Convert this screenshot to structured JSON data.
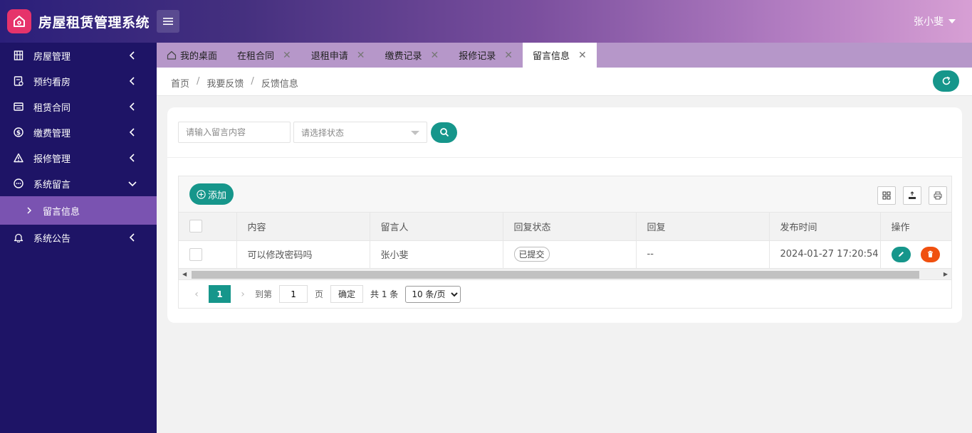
{
  "app": {
    "title": "房屋租赁管理系统",
    "user": "张小斐"
  },
  "sidebar": {
    "items": [
      {
        "label": "房屋管理",
        "icon": "building-icon"
      },
      {
        "label": "预约看房",
        "icon": "calendar-icon"
      },
      {
        "label": "租赁合同",
        "icon": "contract-icon"
      },
      {
        "label": "缴费管理",
        "icon": "dollar-icon"
      },
      {
        "label": "报修管理",
        "icon": "warning-icon"
      },
      {
        "label": "系统留言",
        "icon": "message-icon",
        "expanded": true
      },
      {
        "label": "系统公告",
        "icon": "bell-icon"
      }
    ],
    "sub_item": "留言信息"
  },
  "tabs": [
    {
      "label": "我的桌面",
      "closable": false,
      "active": false
    },
    {
      "label": "在租合同",
      "closable": true,
      "active": false
    },
    {
      "label": "退租申请",
      "closable": true,
      "active": false
    },
    {
      "label": "缴费记录",
      "closable": true,
      "active": false
    },
    {
      "label": "报修记录",
      "closable": true,
      "active": false
    },
    {
      "label": "留言信息",
      "closable": true,
      "active": true
    }
  ],
  "breadcrumb": [
    "首页",
    "我要反馈",
    "反馈信息"
  ],
  "search": {
    "content_placeholder": "请输入留言内容",
    "status_placeholder": "请选择状态"
  },
  "toolbar": {
    "add_label": "添加"
  },
  "table": {
    "columns": [
      "内容",
      "留言人",
      "回复状态",
      "回复",
      "发布时间",
      "操作"
    ],
    "rows": [
      {
        "content": "可以修改密码吗",
        "author": "张小斐",
        "status": "已提交",
        "reply": "--",
        "time": "2024-01-27 17:20:54"
      }
    ]
  },
  "pager": {
    "current": "1",
    "goto_label": "到第",
    "goto_value": "1",
    "page_unit": "页",
    "confirm": "确定",
    "total": "共 1 条",
    "page_size": "10 条/页"
  },
  "colors": {
    "primary": "#16968b",
    "danger": "#f0500f",
    "sidebar": "#1e1466",
    "sidebar_active": "#7a53b1"
  }
}
